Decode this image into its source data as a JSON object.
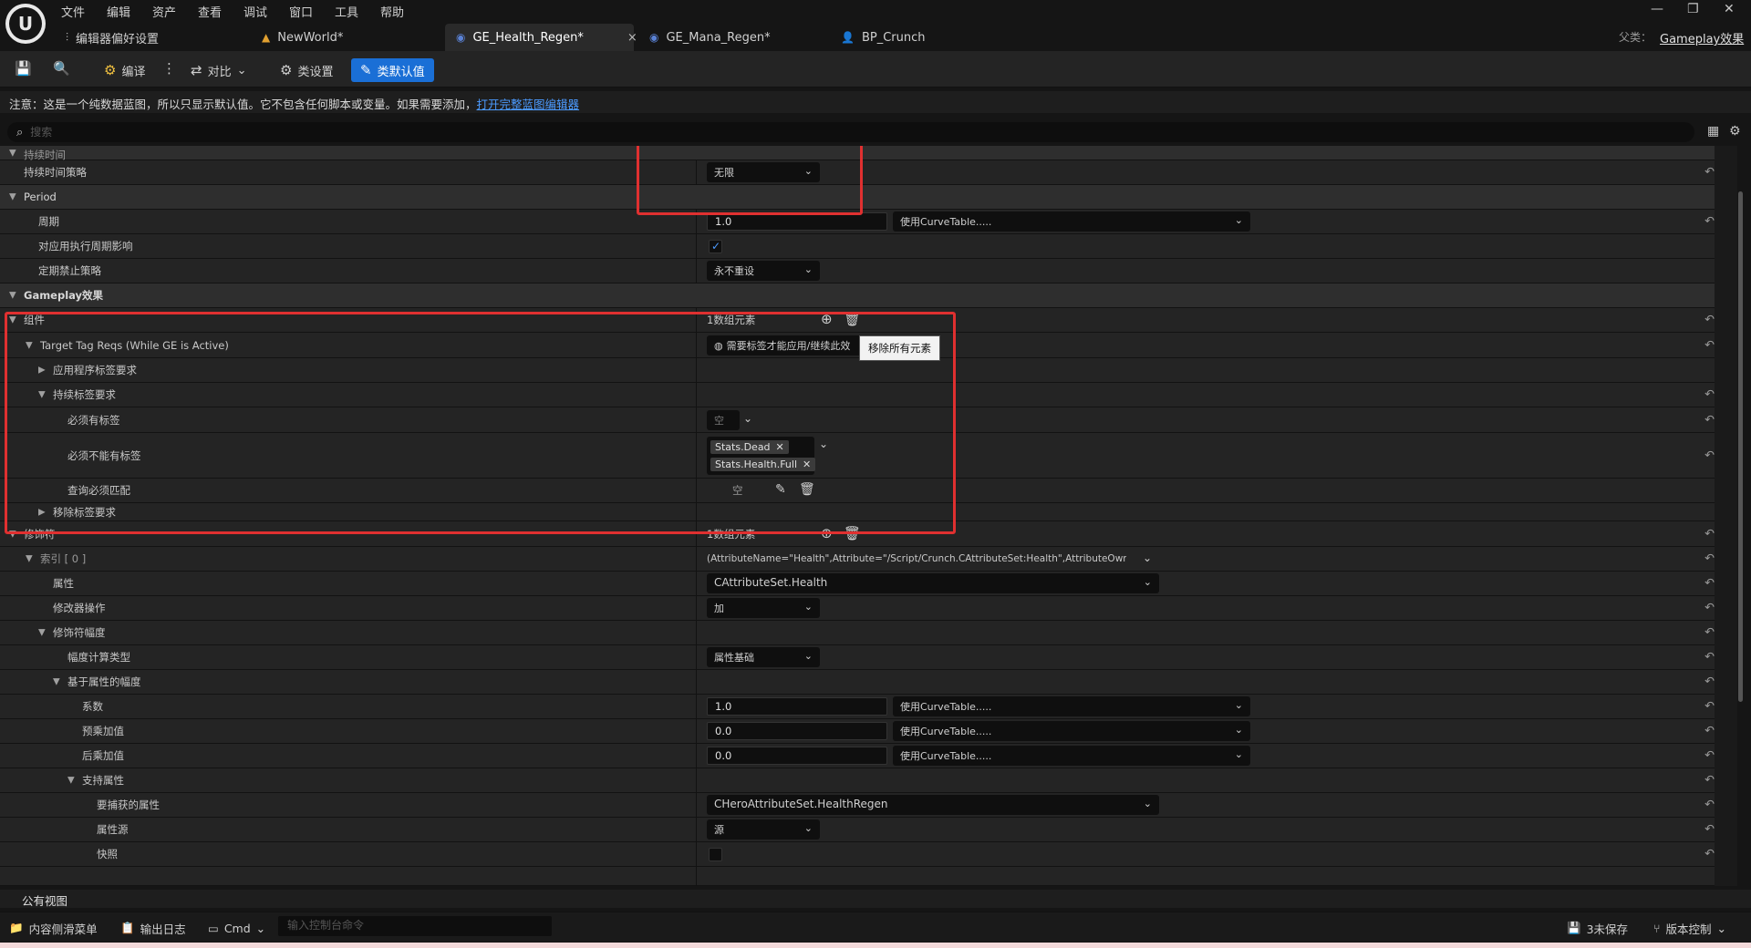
{
  "menu": [
    "文件",
    "编辑",
    "资产",
    "查看",
    "调试",
    "窗口",
    "工具",
    "帮助"
  ],
  "tabs": [
    {
      "label": "编辑器偏好设置",
      "icon": "sliders-icon"
    },
    {
      "label": "NewWorld*",
      "icon": "level-icon"
    },
    {
      "label": "GE_Health_Regen*",
      "icon": "blueprint-icon",
      "close": "×"
    },
    {
      "label": "GE_Mana_Regen*",
      "icon": "blueprint-icon"
    },
    {
      "label": "BP_Crunch",
      "icon": "character-icon"
    }
  ],
  "parent": {
    "label": "父类：",
    "value": "Gameplay效果"
  },
  "toolbar": {
    "compile": "编译",
    "diff": "对比",
    "class_settings": "类设置",
    "class_defaults": "类默认值"
  },
  "note": {
    "text": "注意：这是一个纯数据蓝图，所以只显示默认值。它不包含任何脚本或变量。如果需要添加，",
    "link": "打开完整蓝图编辑器"
  },
  "search": {
    "placeholder": "搜索"
  },
  "rows": {
    "duration_cat": "持续时间",
    "duration_policy": {
      "label": "持续时间策略",
      "value": "无限"
    },
    "period_cat": "Period",
    "period": {
      "label": "周期",
      "value": "1.0",
      "curve": "使用CurveTable....."
    },
    "exec_period": {
      "label": "对应用执行周期影响",
      "checked": true
    },
    "periodic_inhibition": {
      "label": "定期禁止策略",
      "value": "永不重设"
    },
    "ge_cat": "Gameplay效果",
    "components": {
      "label": "组件",
      "count": "1数组元素"
    },
    "target_tag_reqs": {
      "label": "Target Tag Reqs (While GE is Active)",
      "value": "需要标签才能应用/继续此效"
    },
    "tooltip": "移除所有元素",
    "app_tag_reqs": "应用程序标签要求",
    "ongoing_tag_reqs": "持续标签要求",
    "must_have": {
      "label": "必须有标签",
      "value": "空"
    },
    "must_not_have": {
      "label": "必须不能有标签",
      "tags": [
        "Stats.Dead",
        "Stats.Health.Full"
      ]
    },
    "query_match": {
      "label": "查询必须匹配",
      "value": "空"
    },
    "removal_tag_reqs": "移除标签要求",
    "modifiers": {
      "label": "修饰符",
      "count": "1数组元素"
    },
    "index0": {
      "label": "索引 [ 0 ]",
      "value": "(AttributeName=\"Health\",Attribute=\"/Script/Crunch.CAttributeSet:Health\",AttributeOwner=N"
    },
    "attribute": {
      "label": "属性",
      "value": "CAttributeSet.Health"
    },
    "mod_op": {
      "label": "修改器操作",
      "value": "加"
    },
    "mod_mag": "修饰符幅度",
    "mag_calc_type": {
      "label": "幅度计算类型",
      "value": "属性基础"
    },
    "attr_based_mag": "基于属性的幅度",
    "coefficient": {
      "label": "系数",
      "value": "1.0",
      "curve": "使用CurveTable....."
    },
    "pre_mult": {
      "label": "预乘加值",
      "value": "0.0",
      "curve": "使用CurveTable....."
    },
    "post_mult": {
      "label": "后乘加值",
      "value": "0.0",
      "curve": "使用CurveTable....."
    },
    "backing_attr": "支持属性",
    "capture_attr": {
      "label": "要捕获的属性",
      "value": "CHeroAttributeSet.HealthRegen"
    },
    "attr_source": {
      "label": "属性源",
      "value": "源"
    },
    "snapshot": {
      "label": "快照",
      "checked": false
    }
  },
  "public_view": "公有视图",
  "statusbar": {
    "content_drawer": "内容侧滑菜单",
    "output_log": "输出日志",
    "cmd": "Cmd",
    "console_placeholder": "输入控制台命令",
    "unsaved": "3未保存",
    "source_control": "版本控制"
  },
  "colors": {
    "accent": "#1a6fd6",
    "highlight_box": "#e03030",
    "link": "#4c9bff"
  }
}
